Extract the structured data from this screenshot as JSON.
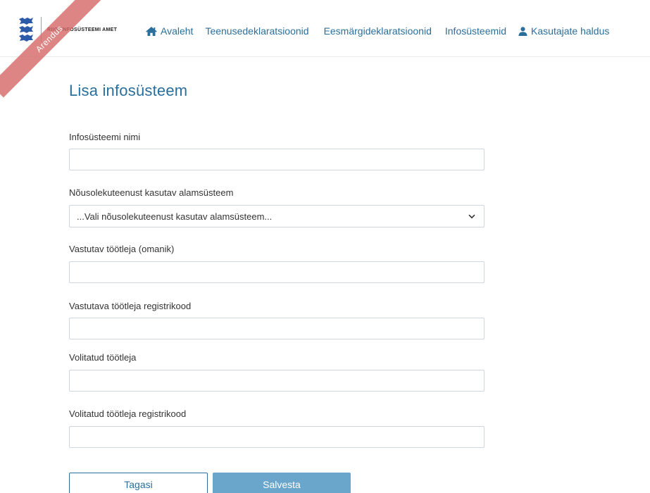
{
  "header": {
    "logo_text": "Riigi Infosüsteemi Amet",
    "environment_badge": "Arendus",
    "nav": {
      "home": "Avaleht",
      "service_declarations": "Teenusedeklaratsioonid",
      "purpose_declarations": "Eesmärgideklaratsioonid",
      "information_systems": "Infosüsteemid",
      "user_management": "Kasutajate haldus"
    }
  },
  "form": {
    "title": "Lisa infosüsteem",
    "fields": [
      {
        "label": "Infosüsteemi nimi",
        "value": ""
      },
      {
        "label": "Nõusolekuteenust kasutav alamsüsteem",
        "value": "...Vali nõusolekuteenust kasutav alamsüsteem..."
      },
      {
        "label": "Vastutav töötleja (omanik)",
        "value": ""
      },
      {
        "label": "Vastutava töötleja registrikood",
        "value": ""
      },
      {
        "label": "Volitatud töötleja",
        "value": ""
      },
      {
        "label": "Volitatud töötleja registrikood",
        "value": ""
      }
    ],
    "buttons": {
      "back": "Tagasi",
      "save": "Salvesta"
    }
  },
  "colors": {
    "accent": "#2a6f9c",
    "save_button": "#6aa5cc",
    "environment_badge": "#d66a6a"
  },
  "icons": {
    "home": "home-icon",
    "user": "user-icon",
    "select": "chevron-down-icon"
  }
}
